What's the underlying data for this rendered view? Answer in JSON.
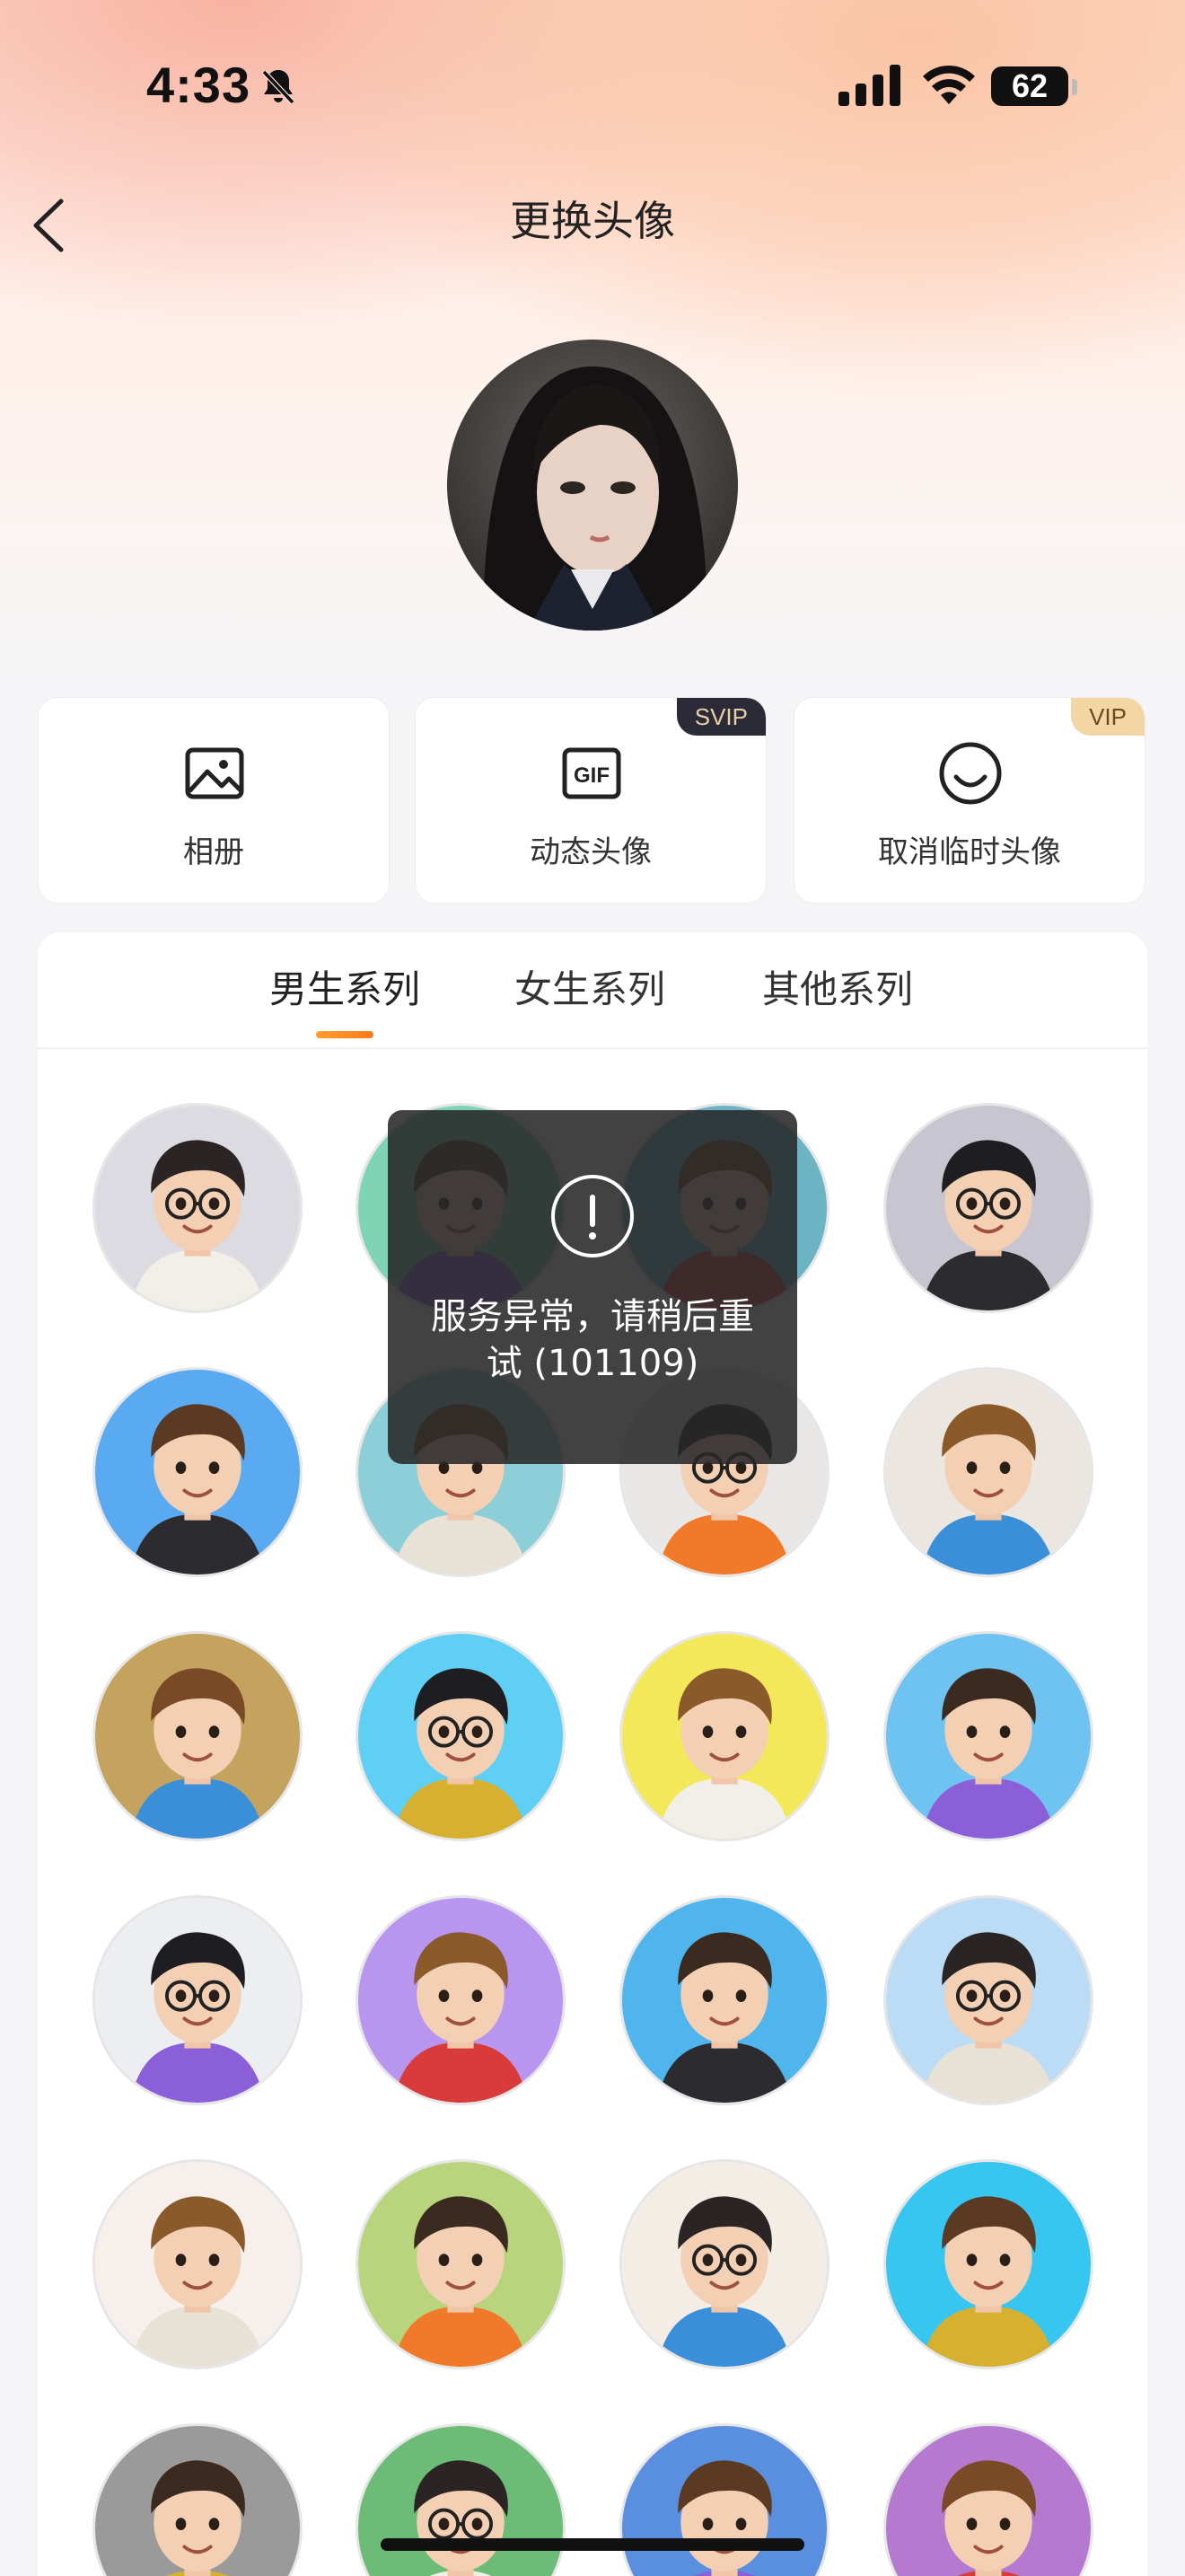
{
  "status_bar": {
    "time": "4:33",
    "battery_level": "62"
  },
  "header": {
    "title": "更换头像"
  },
  "actions": [
    {
      "label": "相册",
      "icon": "image-icon",
      "badge": ""
    },
    {
      "label": "动态头像",
      "icon": "gif-icon",
      "badge": "SVIP"
    },
    {
      "label": "取消临时头像",
      "icon": "smile-icon",
      "badge": "VIP"
    }
  ],
  "series_tabs": [
    {
      "label": "男生系列",
      "active": true
    },
    {
      "label": "女生系列",
      "active": false
    },
    {
      "label": "其他系列",
      "active": false
    }
  ],
  "toast": {
    "message": "服务异常，请稍后重试 (101109)"
  },
  "colors": {
    "accent": "#ff8a24",
    "svip_badge": "#2b2b37",
    "vip_badge": "#f2d6a4"
  }
}
